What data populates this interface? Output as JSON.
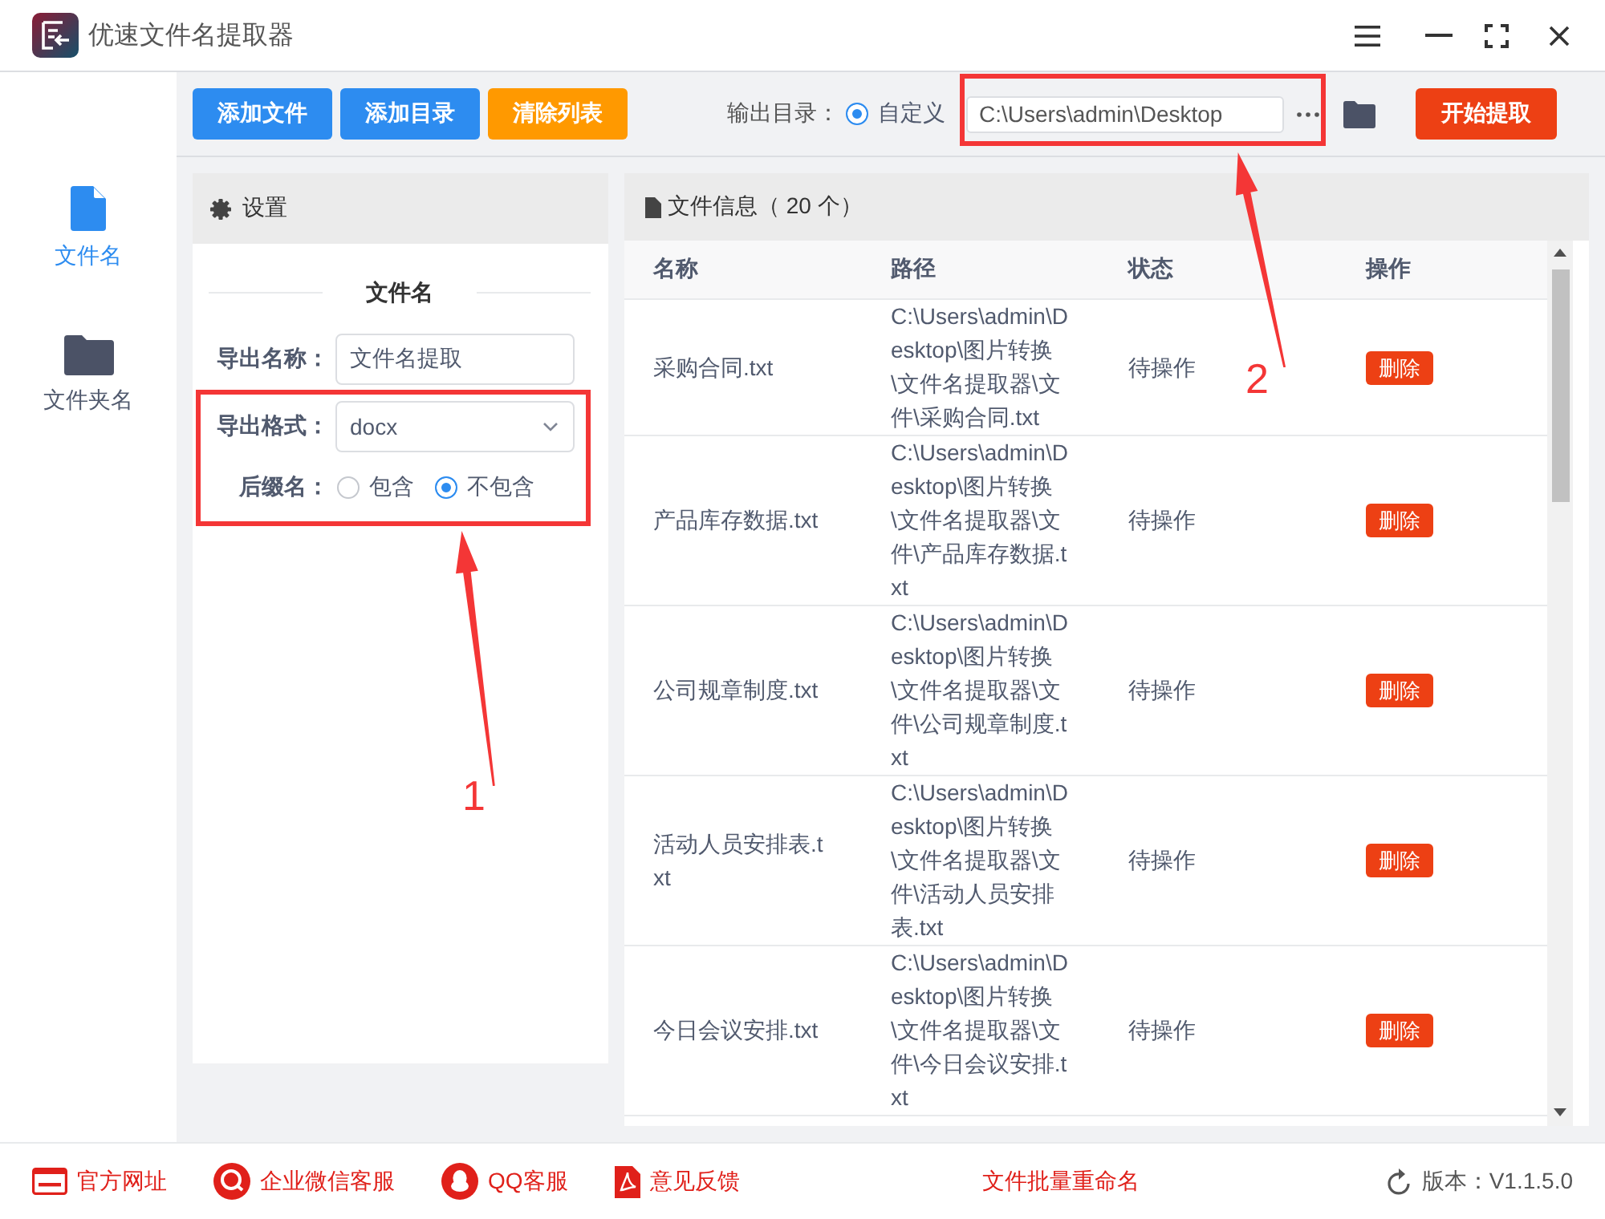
{
  "window": {
    "title": "优速文件名提取器"
  },
  "sidebar": {
    "items": [
      {
        "label": "文件名",
        "kind": "file",
        "selected": true
      },
      {
        "label": "文件夹名",
        "kind": "folder",
        "selected": false
      }
    ]
  },
  "toolbar": {
    "buttons": [
      {
        "label": "添加文件",
        "kind": "add-file"
      },
      {
        "label": "添加目录",
        "kind": "add-folder"
      },
      {
        "label": "清除列表",
        "kind": "clear-list"
      }
    ],
    "output_dir": {
      "label": "输出目录：",
      "option": {
        "label": "自定义",
        "selected": true
      },
      "path": "C:\\Users\\admin\\Desktop"
    },
    "start_button": "开始提取"
  },
  "settings": {
    "title": "设置",
    "section": "文件名",
    "fields": [
      {
        "label": "导出名称：",
        "kind": "input",
        "value": "文件名提取"
      },
      {
        "label": "导出格式：",
        "kind": "select",
        "value": "docx"
      },
      {
        "label": "后缀名：",
        "kind": "radio",
        "options": [
          {
            "label": "包含",
            "selected": false
          },
          {
            "label": "不包含",
            "selected": true
          }
        ]
      }
    ]
  },
  "file_table": {
    "title": "文件信息（ 20 个）",
    "columns": [
      "名称",
      "路径",
      "状态",
      "操作"
    ],
    "rows": [
      {
        "name": "采购合同.txt",
        "path": "C:\\Users\\admin\\Desktop\\图片转换\\文件名提取器\\文件\\采购合同.txt",
        "status": "待操作",
        "action": "删除"
      },
      {
        "name": "产品库存数据.txt",
        "path": "C:\\Users\\admin\\Desktop\\图片转换\\文件名提取器\\文件\\产品库存数据.txt",
        "status": "待操作",
        "action": "删除"
      },
      {
        "name": "公司规章制度.txt",
        "path": "C:\\Users\\admin\\Desktop\\图片转换\\文件名提取器\\文件\\公司规章制度.txt",
        "status": "待操作",
        "action": "删除"
      },
      {
        "name": "活动人员安排表.txt",
        "path": "C:\\Users\\admin\\Desktop\\图片转换\\文件名提取器\\文件\\活动人员安排表.txt",
        "status": "待操作",
        "action": "删除"
      },
      {
        "name": "今日会议安排.txt",
        "path": "C:\\Users\\admin\\Desktop\\图片转换\\文件名提取器\\文件\\今日会议安排.txt",
        "status": "待操作",
        "action": "删除"
      }
    ]
  },
  "footer": {
    "links": [
      {
        "label": "官方网址",
        "kind": "web"
      },
      {
        "label": "企业微信客服",
        "kind": "chat"
      },
      {
        "label": "QQ客服",
        "kind": "qq"
      },
      {
        "label": "意见反馈",
        "kind": "pdf"
      }
    ],
    "promo": "文件批量重命名",
    "version": "版本：V1.1.5.0"
  },
  "annotations": [
    {
      "label": "1"
    },
    {
      "label": "2"
    }
  ]
}
